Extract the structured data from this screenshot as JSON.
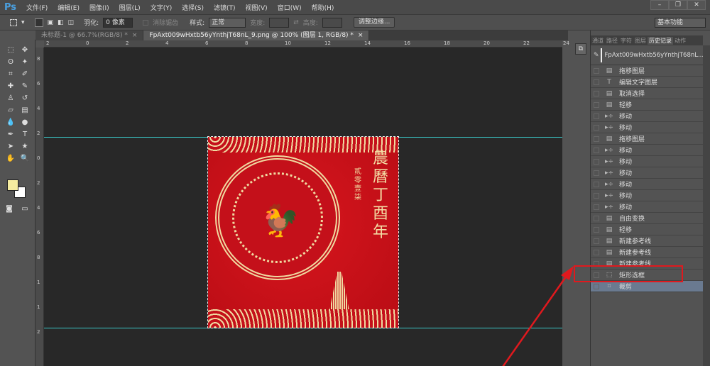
{
  "app": {
    "logo": "Ps",
    "menu": [
      "文件(F)",
      "编辑(E)",
      "图像(I)",
      "图层(L)",
      "文字(Y)",
      "选择(S)",
      "滤镜(T)",
      "视图(V)",
      "窗口(W)",
      "帮助(H)"
    ],
    "window_buttons": [
      "–",
      "❐",
      "✕"
    ]
  },
  "options": {
    "feather_label": "羽化:",
    "feather_value": "0 像素",
    "antialias_label": "消除锯齿",
    "style_label": "样式:",
    "style_value": "正常",
    "width_label": "宽度:",
    "height_label": "高度:",
    "refine_button": "调整边缘...",
    "workspace": "基本功能"
  },
  "tabs": [
    {
      "label": "未标题-1 @ 66.7%(RGB/8) *",
      "close": "×"
    },
    {
      "label": "FpAxt009wHxtb56yYnthjT68nL_9.png @ 100% (图层 1, RGB/8) *",
      "close": "×"
    }
  ],
  "ruler": {
    "top": [
      "2",
      "0",
      "2",
      "4",
      "6",
      "8",
      "10",
      "12",
      "14",
      "16",
      "18",
      "20",
      "22",
      "24"
    ],
    "left": [
      "8",
      "6",
      "4",
      "2",
      "0",
      "2",
      "4",
      "6",
      "8",
      "1",
      "1",
      "2"
    ]
  },
  "artwork": {
    "calligraphy": "農曆丁酉年",
    "side_text": "貳零壹柒"
  },
  "colors": {
    "guide": "#3ac8c8",
    "highlight": "#e0191e",
    "foreground": "#f5eca0",
    "background": "#ffffff"
  },
  "panel": {
    "tabs": [
      "通道",
      "路径",
      "字符",
      "图层",
      "历史记录",
      "动作"
    ],
    "active_tab": "历史记录",
    "snapshot": "FpAxt009wHxtb56yYnthjT68nL...",
    "history": [
      {
        "icon": "doc",
        "label": "拖移图层"
      },
      {
        "icon": "text",
        "label": "编辑文字图层"
      },
      {
        "icon": "doc",
        "label": "取消选择"
      },
      {
        "icon": "doc",
        "label": "轻移"
      },
      {
        "icon": "move",
        "label": "移动"
      },
      {
        "icon": "move",
        "label": "移动"
      },
      {
        "icon": "doc",
        "label": "拖移图层"
      },
      {
        "icon": "move",
        "label": "移动"
      },
      {
        "icon": "move",
        "label": "移动"
      },
      {
        "icon": "move",
        "label": "移动"
      },
      {
        "icon": "move",
        "label": "移动"
      },
      {
        "icon": "move",
        "label": "移动"
      },
      {
        "icon": "move",
        "label": "移动"
      },
      {
        "icon": "doc",
        "label": "自由变换"
      },
      {
        "icon": "doc",
        "label": "轻移"
      },
      {
        "icon": "doc",
        "label": "新建参考线"
      },
      {
        "icon": "doc",
        "label": "新建参考线"
      },
      {
        "icon": "doc",
        "label": "新建参考线"
      },
      {
        "icon": "marquee",
        "label": "矩形选框"
      },
      {
        "icon": "crop",
        "label": "裁剪"
      }
    ],
    "selected": "裁剪",
    "highlighted": "矩形选框"
  }
}
